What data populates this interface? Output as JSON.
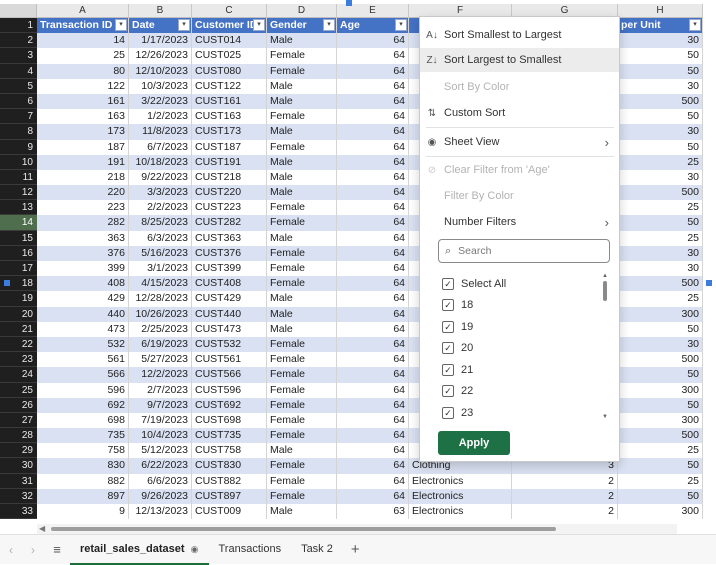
{
  "sheet": {
    "columns": [
      "A",
      "B",
      "C",
      "D",
      "E",
      "F",
      "G",
      "H"
    ],
    "headers": [
      "Transaction ID",
      "Date",
      "Customer ID",
      "Gender",
      "Age",
      "",
      "",
      "per Unit"
    ],
    "row_numbers": [
      "1",
      "2",
      "3",
      "4",
      "5",
      "6",
      "7",
      "8",
      "9",
      "10",
      "11",
      "12",
      "13",
      "14",
      "15",
      "16",
      "17",
      "18",
      "19",
      "20",
      "21",
      "22",
      "23",
      "24",
      "25",
      "26",
      "27",
      "28",
      "29",
      "30",
      "31",
      "32",
      "33"
    ],
    "rows": [
      [
        "14",
        "1/17/2023",
        "CUST014",
        "Male",
        "64",
        "",
        "",
        "30"
      ],
      [
        "25",
        "12/26/2023",
        "CUST025",
        "Female",
        "64",
        "",
        "",
        "50"
      ],
      [
        "80",
        "12/10/2023",
        "CUST080",
        "Female",
        "64",
        "",
        "",
        "50"
      ],
      [
        "122",
        "10/3/2023",
        "CUST122",
        "Male",
        "64",
        "",
        "",
        "30"
      ],
      [
        "161",
        "3/22/2023",
        "CUST161",
        "Male",
        "64",
        "",
        "",
        "500"
      ],
      [
        "163",
        "1/2/2023",
        "CUST163",
        "Female",
        "64",
        "",
        "",
        "50"
      ],
      [
        "173",
        "11/8/2023",
        "CUST173",
        "Male",
        "64",
        "",
        "",
        "30"
      ],
      [
        "187",
        "6/7/2023",
        "CUST187",
        "Female",
        "64",
        "",
        "",
        "50"
      ],
      [
        "191",
        "10/18/2023",
        "CUST191",
        "Male",
        "64",
        "",
        "",
        "25"
      ],
      [
        "218",
        "9/22/2023",
        "CUST218",
        "Male",
        "64",
        "",
        "",
        "30"
      ],
      [
        "220",
        "3/3/2023",
        "CUST220",
        "Male",
        "64",
        "",
        "",
        "500"
      ],
      [
        "223",
        "2/2/2023",
        "CUST223",
        "Female",
        "64",
        "",
        "",
        "25"
      ],
      [
        "282",
        "8/25/2023",
        "CUST282",
        "Female",
        "64",
        "",
        "",
        "50"
      ],
      [
        "363",
        "6/3/2023",
        "CUST363",
        "Male",
        "64",
        "",
        "",
        "25"
      ],
      [
        "376",
        "5/16/2023",
        "CUST376",
        "Female",
        "64",
        "",
        "",
        "30"
      ],
      [
        "399",
        "3/1/2023",
        "CUST399",
        "Female",
        "64",
        "",
        "",
        "30"
      ],
      [
        "408",
        "4/15/2023",
        "CUST408",
        "Female",
        "64",
        "",
        "",
        "500"
      ],
      [
        "429",
        "12/28/2023",
        "CUST429",
        "Male",
        "64",
        "",
        "",
        "25"
      ],
      [
        "440",
        "10/26/2023",
        "CUST440",
        "Male",
        "64",
        "",
        "",
        "300"
      ],
      [
        "473",
        "2/25/2023",
        "CUST473",
        "Male",
        "64",
        "",
        "",
        "50"
      ],
      [
        "532",
        "6/19/2023",
        "CUST532",
        "Female",
        "64",
        "",
        "",
        "30"
      ],
      [
        "561",
        "5/27/2023",
        "CUST561",
        "Female",
        "64",
        "",
        "",
        "500"
      ],
      [
        "566",
        "12/2/2023",
        "CUST566",
        "Female",
        "64",
        "",
        "",
        "50"
      ],
      [
        "596",
        "2/7/2023",
        "CUST596",
        "Female",
        "64",
        "",
        "",
        "300"
      ],
      [
        "692",
        "9/7/2023",
        "CUST692",
        "Female",
        "64",
        "",
        "",
        "50"
      ],
      [
        "698",
        "7/19/2023",
        "CUST698",
        "Female",
        "64",
        "",
        "",
        "300"
      ],
      [
        "735",
        "10/4/2023",
        "CUST735",
        "Female",
        "64",
        "",
        "",
        "500"
      ],
      [
        "758",
        "5/12/2023",
        "CUST758",
        "Male",
        "64",
        "",
        "",
        "25"
      ],
      [
        "830",
        "6/22/2023",
        "CUST830",
        "Female",
        "64",
        "Clothing",
        "3",
        "50"
      ],
      [
        "882",
        "6/6/2023",
        "CUST882",
        "Female",
        "64",
        "Electronics",
        "2",
        "25"
      ],
      [
        "897",
        "9/26/2023",
        "CUST897",
        "Female",
        "64",
        "Electronics",
        "2",
        "50"
      ],
      [
        "9",
        "12/13/2023",
        "CUST009",
        "Male",
        "63",
        "Electronics",
        "2",
        "300"
      ]
    ]
  },
  "filter_menu": {
    "sort_asc": "Sort Smallest to Largest",
    "sort_desc": "Sort Largest to Smallest",
    "sort_by_color": "Sort By Color",
    "custom_sort": "Custom Sort",
    "sheet_view": "Sheet View",
    "clear_filter": "Clear Filter from 'Age'",
    "filter_by_color": "Filter By Color",
    "number_filters": "Number Filters",
    "search_placeholder": "Search",
    "options": [
      "Select All",
      "18",
      "19",
      "20",
      "21",
      "22",
      "23"
    ],
    "apply_label": "Apply"
  },
  "tabs": {
    "items": [
      "retail_sales_dataset",
      "Transactions",
      "Task 2"
    ],
    "active": "retail_sales_dataset",
    "add_label": "+"
  },
  "colors": {
    "header_blue": "#4472c4",
    "band_blue": "#d9e1f2",
    "apply_green": "#1e7145",
    "active_tab_green": "#1b6e3a"
  }
}
